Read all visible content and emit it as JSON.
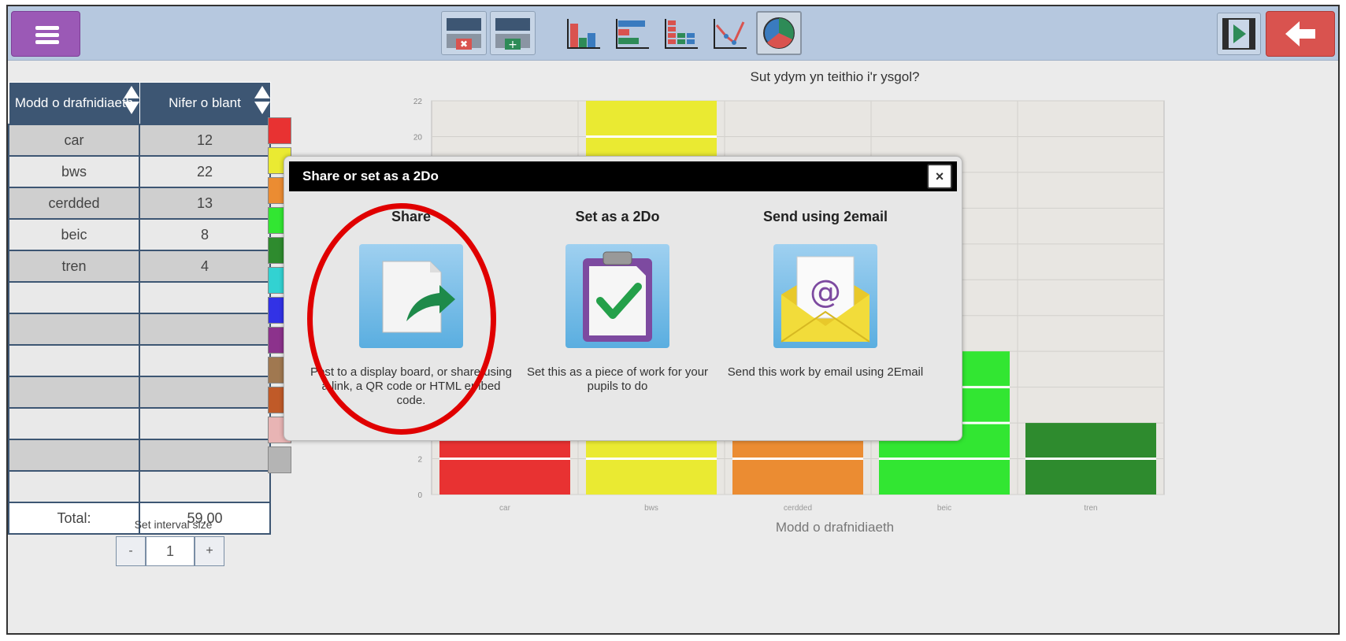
{
  "toolbar": {
    "menu_icon": "hamburger-icon",
    "buttons": [
      "remove-row-icon",
      "add-row-icon",
      "bar-chart-icon",
      "horizontal-bar-icon",
      "stacked-bar-icon",
      "line-chart-icon",
      "pie-chart-icon"
    ],
    "active_button": "pie-chart-icon",
    "right_buttons": [
      "film-play-icon",
      "back-arrow-icon"
    ]
  },
  "table": {
    "headers": [
      "Modd o drafnidiaeth",
      "Nifer o blant"
    ],
    "rows": [
      {
        "label": "car",
        "value": "12",
        "color": "#e83232"
      },
      {
        "label": "bws",
        "value": "22",
        "color": "#eaea32"
      },
      {
        "label": "cerdded",
        "value": "13",
        "color": "#eb8c32"
      },
      {
        "label": "beic",
        "value": "8",
        "color": "#32e632"
      },
      {
        "label": "tren",
        "value": "4",
        "color": "#2e8b2e"
      },
      {
        "label": "",
        "value": "",
        "color": "#32d2d2"
      },
      {
        "label": "",
        "value": "",
        "color": "#3232e6"
      },
      {
        "label": "",
        "value": "",
        "color": "#8c328c"
      },
      {
        "label": "",
        "value": "",
        "color": "#a07850"
      },
      {
        "label": "",
        "value": "",
        "color": "#c05a28"
      },
      {
        "label": "",
        "value": "",
        "color": "#e8b4b4"
      },
      {
        "label": "",
        "value": "",
        "color": "#b4b4b4"
      }
    ],
    "total_label": "Total:",
    "total_value": "59.00"
  },
  "interval": {
    "label": "Set interval size",
    "minus": "-",
    "value": "1",
    "plus": "+"
  },
  "chart_data": {
    "type": "bar",
    "title": "Sut ydym yn teithio i'r ysgol?",
    "xlabel": "Modd o drafnidiaeth",
    "ylabel": "",
    "categories": [
      "car",
      "bws",
      "cerdded",
      "beic",
      "tren"
    ],
    "values": [
      12,
      22,
      13,
      8,
      4
    ],
    "colors": [
      "#e83232",
      "#eaea32",
      "#eb8c32",
      "#32e632",
      "#2e8b2e"
    ],
    "ylim": [
      0,
      22
    ],
    "yticks": [
      0,
      2,
      20,
      22
    ],
    "grid": true
  },
  "dialog": {
    "title": "Share or set as a 2Do",
    "close": "×",
    "options": [
      {
        "title": "Share",
        "icon": "share-document-icon",
        "desc": "Post to a display board, or share using a link, a QR code or HTML embed code."
      },
      {
        "title": "Set as a 2Do",
        "icon": "clipboard-check-icon",
        "desc": "Set this as a piece of work for your pupils to do"
      },
      {
        "title": "Send using 2email",
        "icon": "email-envelope-icon",
        "desc": "Send this work by email using 2Email"
      }
    ]
  }
}
